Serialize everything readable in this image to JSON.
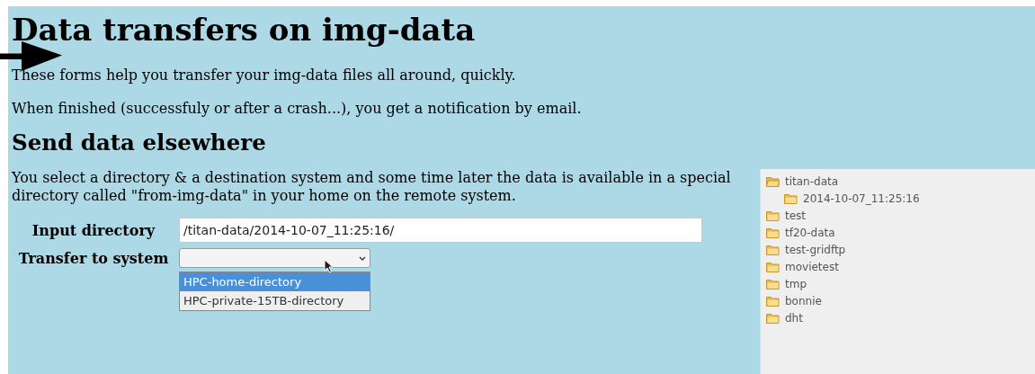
{
  "title": "Data transfers on img-data",
  "intro": [
    "These forms help you transfer your img-data files all around, quickly.",
    "When finished (successfuly or after a crash...), you get a notification by email."
  ],
  "section": {
    "heading": "Send data elsewhere",
    "description": "You select a directory & a destination system and some time later the data is available in a special directory called \"from-img-data\" in your home on the remote system.",
    "fields": [
      {
        "kind": "text",
        "label": "Input directory",
        "value": "/titan-data/2014-10-07_11:25:16/"
      },
      {
        "kind": "select",
        "label": "Transfer to system",
        "expanded": true,
        "options": [
          {
            "label": "HPC-home-directory",
            "selected": true
          },
          {
            "label": "HPC-private-15TB-directory",
            "selected": false
          }
        ]
      }
    ]
  },
  "tree": [
    {
      "name": "titan-data",
      "expanded": true,
      "children": [
        {
          "name": "2014-10-07_11:25:16"
        }
      ]
    },
    {
      "name": "test",
      "expanded": false
    },
    {
      "name": "tf20-data",
      "expanded": false
    },
    {
      "name": "test-gridftp",
      "expanded": false
    },
    {
      "name": "movietest",
      "expanded": false
    },
    {
      "name": "tmp",
      "expanded": false
    },
    {
      "name": "bonnie",
      "expanded": false
    },
    {
      "name": "dht",
      "expanded": false
    }
  ]
}
